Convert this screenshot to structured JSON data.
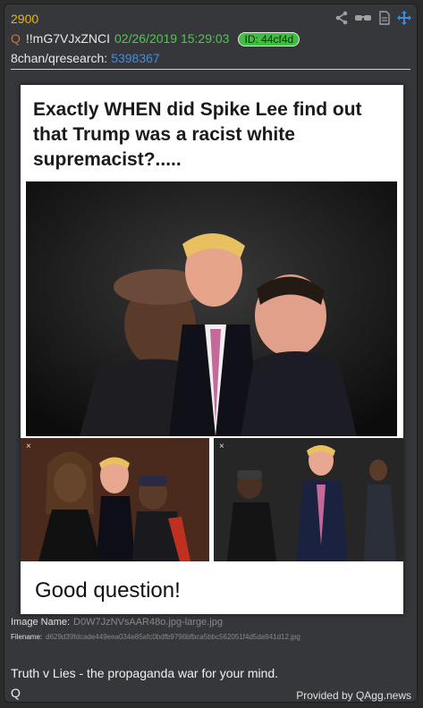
{
  "post": {
    "number": "2900",
    "q_marker": "Q",
    "tripcode": "!!mG7VJxZNCI",
    "datetime": "02/26/2019 15:29:03",
    "id_label": "ID: 44cf4d",
    "board": "8chan/qresearch:",
    "thread_no": "5398367"
  },
  "image": {
    "headline": "Exactly WHEN did Spike Lee find out that Trump was a racist white supremacist?.....",
    "caption": "Good question!",
    "sub1_close": "×",
    "sub2_close": "×"
  },
  "file": {
    "name_label": "Image Name:",
    "name_value": "D0W7JzNVsAAR48o.jpg-large.jpg",
    "filename_label": "Filename:",
    "filename_value": "d629d39fdcade449eea034e85afc0bdfb9796bfbca5bbc562051f4d5da941d12.jpg"
  },
  "body": {
    "line1": "Truth v Lies - the propaganda war for your mind.",
    "line2": "Q"
  },
  "footer": {
    "provided": "Provided by QAgg.news"
  },
  "icons": [
    "share-icon",
    "glasses-icon",
    "document-icon",
    "move-icon"
  ],
  "colors": {
    "post_number": "#f0b400",
    "date": "#4ec94e",
    "thread_link": "#3a8ee6",
    "id_badge": "#3fbf3f"
  }
}
